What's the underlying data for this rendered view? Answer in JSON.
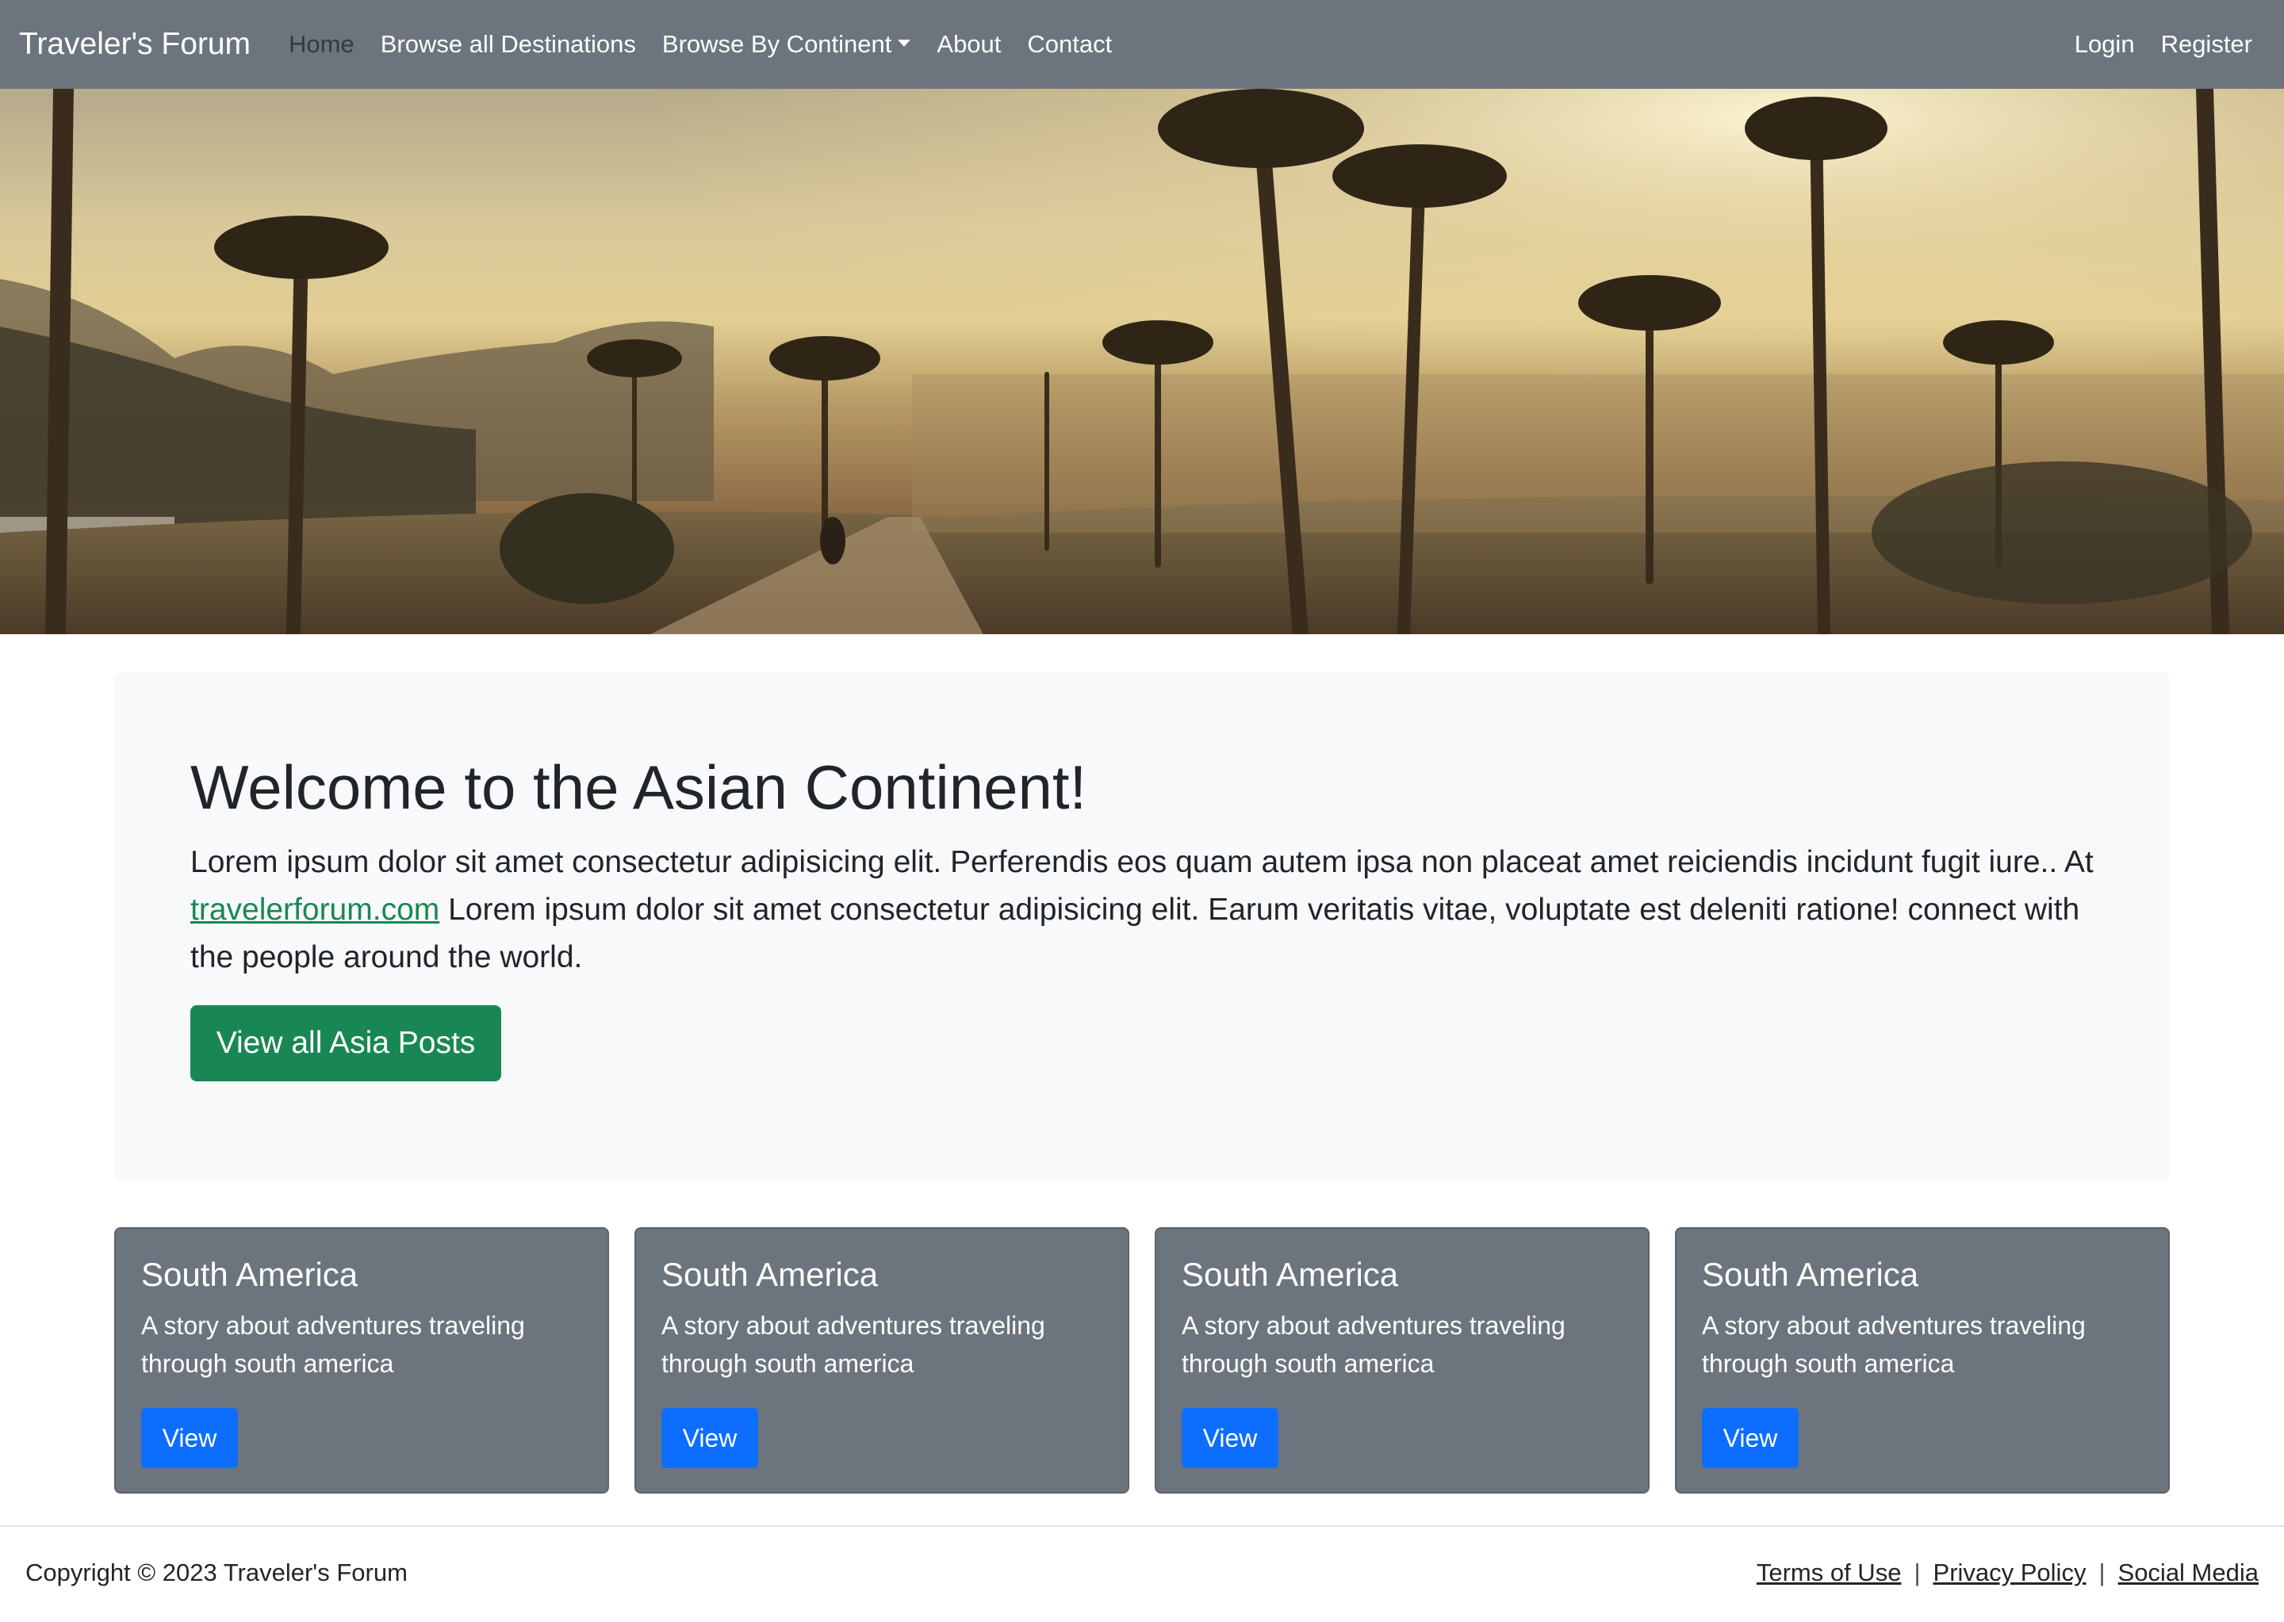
{
  "navbar": {
    "brand": "Traveler's Forum",
    "links": [
      {
        "label": "Home",
        "active": true
      },
      {
        "label": "Browse all Destinations"
      },
      {
        "label": "Browse By Continent",
        "dropdown": true
      },
      {
        "label": "About"
      },
      {
        "label": "Contact"
      }
    ],
    "right_links": [
      {
        "label": "Login"
      },
      {
        "label": "Register"
      }
    ]
  },
  "hero": {
    "image": "tropical-road-palm-trees-photo"
  },
  "jumbotron": {
    "title": "Welcome to the Asian Continent!",
    "text_before_link": "Lorem ipsum dolor sit amet consectetur adipisicing elit. Perferendis eos quam autem ipsa non placeat amet reiciendis incidunt fugit iure.. At ",
    "link_text": "travelerforum.com",
    "text_after_link": " Lorem ipsum dolor sit amet consectetur adipisicing elit. Earum veritatis vitae, voluptate est deleniti ratione! connect with the people around the world.",
    "button_label": "View all Asia Posts"
  },
  "cards": [
    {
      "title": "South America",
      "text": "A story about adventures traveling through south america",
      "button": "View"
    },
    {
      "title": "South America",
      "text": "A story about adventures traveling through south america",
      "button": "View"
    },
    {
      "title": "South America",
      "text": "A story about adventures traveling through south america",
      "button": "View"
    },
    {
      "title": "South America",
      "text": "A story about adventures traveling through south america",
      "button": "View"
    }
  ],
  "footer": {
    "copyright": "Copyright © 2023 Traveler's Forum",
    "links": [
      "Terms of Use",
      "Privacy Policy",
      "Social Media"
    ],
    "separator": "|"
  },
  "colors": {
    "navbar_bg": "#6c757d",
    "success": "#198754",
    "primary": "#0d6efd",
    "card_bg": "#6c757d",
    "jumbotron_bg": "#f8f9fa"
  }
}
